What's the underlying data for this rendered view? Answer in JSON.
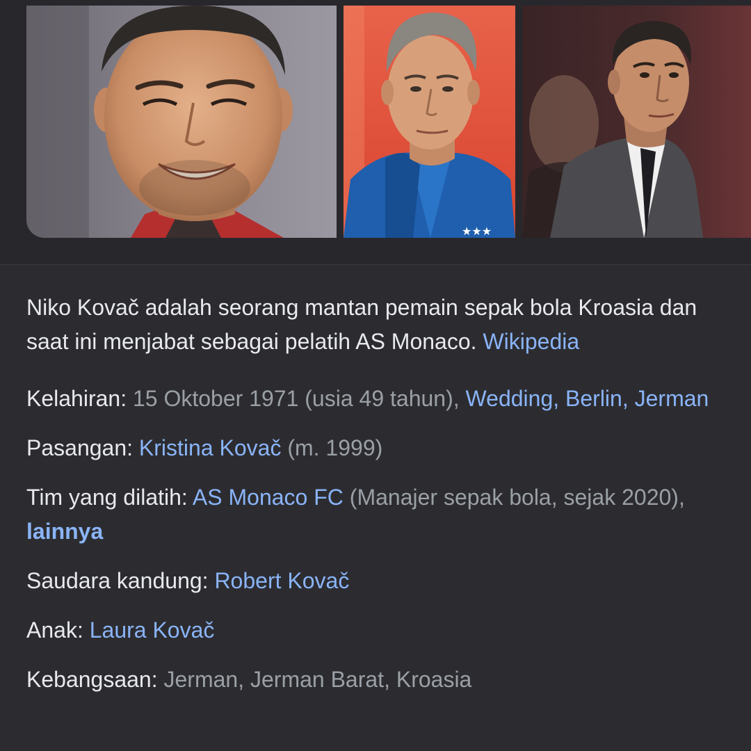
{
  "gallery": {
    "images": [
      {
        "alt": "Niko Kovač"
      },
      {
        "alt": "Niko Kovač"
      },
      {
        "alt": "Niko Kovač"
      }
    ]
  },
  "description": {
    "text": "Niko Kovač adalah seorang mantan pemain sepak bola Kroasia dan saat ini menjabat sebagai pelatih AS Monaco.",
    "source_link": "Wikipedia"
  },
  "facts": {
    "birth": {
      "label": "Kelahiran:",
      "value": "15 Oktober 1971 (usia 49 tahun),",
      "link": "Wedding, Berlin, Jerman"
    },
    "spouse": {
      "label": "Pasangan:",
      "link": "Kristina Kovač",
      "value": "(m. 1999)"
    },
    "teams": {
      "label": "Tim yang dilatih:",
      "link": "AS Monaco FC",
      "value": "(Manajer sepak bola, sejak 2020),",
      "more_link": "lainnya"
    },
    "sibling": {
      "label": "Saudara kandung:",
      "link": "Robert Kovač"
    },
    "child": {
      "label": "Anak:",
      "link": "Laura Kovač"
    },
    "nationality": {
      "label": "Kebangsaan:",
      "value": "Jerman, Jerman Barat, Kroasia"
    }
  },
  "colors": {
    "background": "#2c2c30",
    "text": "#e8eaed",
    "secondary_text": "#9aa0a6",
    "link": "#8ab4f8"
  }
}
